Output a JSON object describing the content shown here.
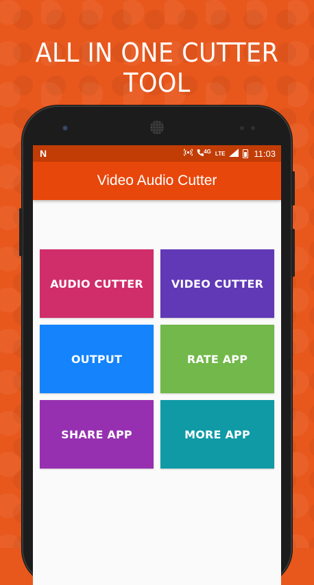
{
  "promo": {
    "headline": "ALL IN ONE CUTTER TOOL"
  },
  "status_bar": {
    "notification_icon": "N",
    "network_4g": "4G",
    "network_lte": "LTE",
    "time": "11:03"
  },
  "app_bar": {
    "title": "Video Audio Cutter"
  },
  "tiles": [
    {
      "label": "AUDIO CUTTER",
      "color": "#d02d6b"
    },
    {
      "label": "VIDEO CUTTER",
      "color": "#6139b6"
    },
    {
      "label": "OUTPUT",
      "color": "#1483fc"
    },
    {
      "label": "RATE APP",
      "color": "#72b84a"
    },
    {
      "label": "SHARE APP",
      "color": "#9630b0"
    },
    {
      "label": "MORE APP",
      "color": "#0f9aa6"
    }
  ],
  "colors": {
    "background": "#e8571c",
    "status_bar": "#c23c06",
    "app_bar": "#e8470b"
  }
}
